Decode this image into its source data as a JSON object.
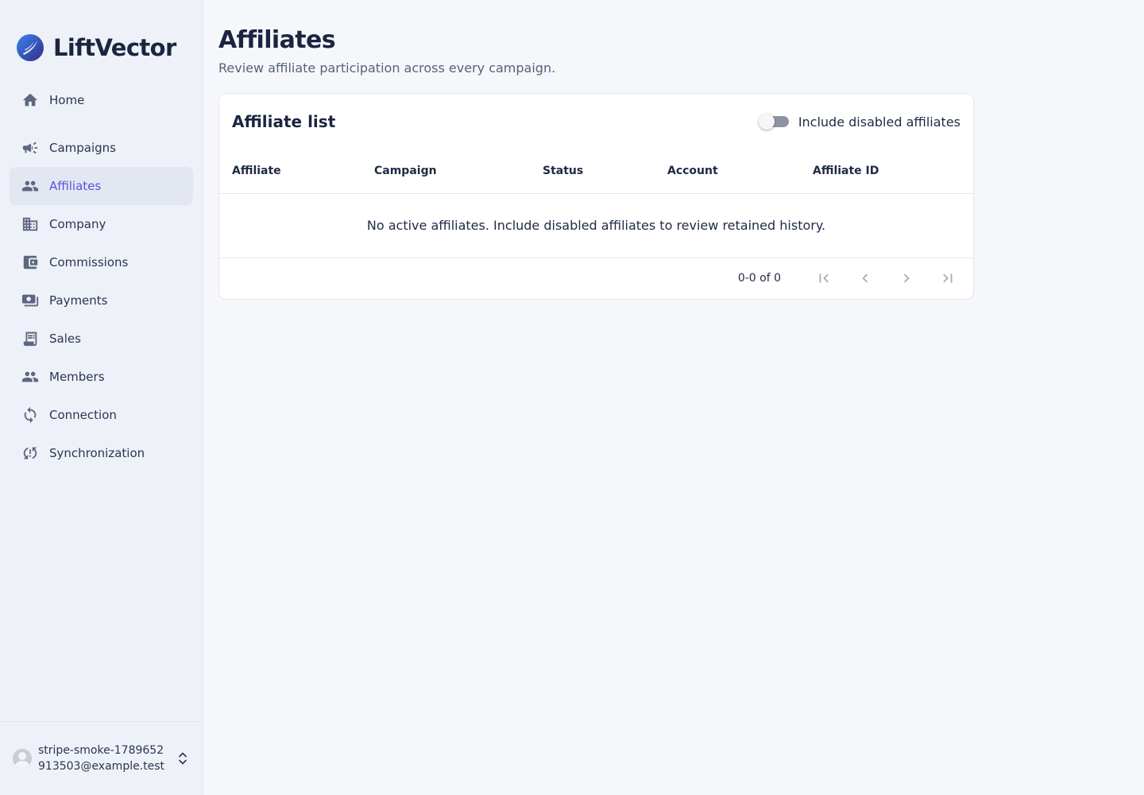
{
  "brand": {
    "name": "LiftVector",
    "accent": "#4338ca"
  },
  "sidebar": {
    "items": [
      {
        "label": "Home",
        "icon": "home-icon"
      },
      {
        "label": "Campaigns",
        "icon": "megaphone-icon"
      },
      {
        "label": "Affiliates",
        "icon": "people-icon",
        "active": true
      },
      {
        "label": "Company",
        "icon": "building-icon"
      },
      {
        "label": "Commissions",
        "icon": "wallet-icon"
      },
      {
        "label": "Payments",
        "icon": "payments-icon"
      },
      {
        "label": "Sales",
        "icon": "receipt-icon"
      },
      {
        "label": "Members",
        "icon": "people-icon"
      },
      {
        "label": "Connection",
        "icon": "sync-icon"
      },
      {
        "label": "Synchronization",
        "icon": "sync-problem-icon"
      }
    ],
    "active_color": "#5b4fe6"
  },
  "account": {
    "email": "stripe-smoke-1789652913503@example.test"
  },
  "page": {
    "title": "Affiliates",
    "subtitle": "Review affiliate participation across every campaign."
  },
  "card": {
    "title": "Affiliate list",
    "toggle_label": "Include disabled affiliates",
    "toggle_on": false,
    "columns": [
      "Affiliate",
      "Campaign",
      "Status",
      "Account",
      "Affiliate ID"
    ],
    "empty_message": "No active affiliates. Include disabled affiliates to review retained history.",
    "pagination": {
      "range": "0-0 of 0"
    }
  }
}
